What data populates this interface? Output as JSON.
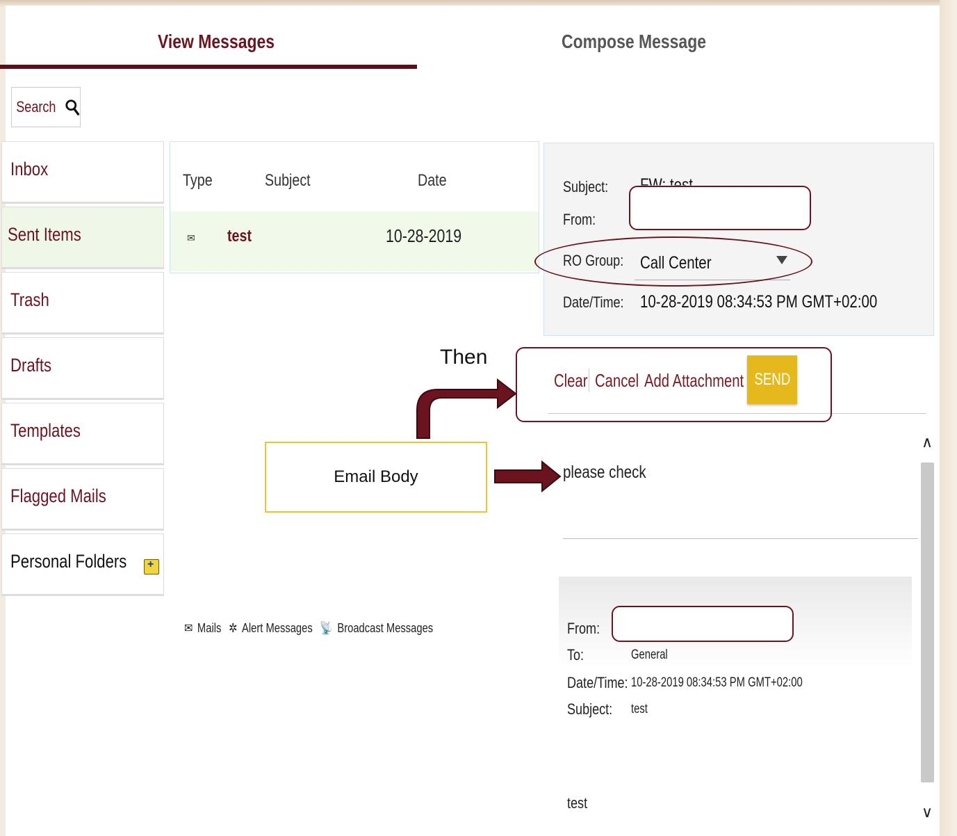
{
  "tabs": {
    "view": "View Messages",
    "compose": "Compose Message"
  },
  "search": {
    "label": "Search"
  },
  "sidebar": {
    "items": [
      {
        "label": "Inbox"
      },
      {
        "label": "Sent Items"
      },
      {
        "label": "Trash"
      },
      {
        "label": "Drafts"
      },
      {
        "label": "Templates"
      },
      {
        "label": "Flagged Mails"
      },
      {
        "label": "Personal Folders"
      }
    ]
  },
  "message_list": {
    "headers": {
      "type": "Type",
      "subject": "Subject",
      "date": "Date"
    },
    "rows": [
      {
        "subject": "test",
        "date": "10-28-2019"
      }
    ]
  },
  "legend": {
    "mails": "Mails",
    "alerts": "Alert Messages",
    "broadcast": "Broadcast Messages"
  },
  "detail": {
    "subject_label": "Subject:",
    "subject_value": "FW: test",
    "from_label": "From:",
    "ro_group_label": "RO Group:",
    "ro_group_value": "Call Center",
    "datetime_label": "Date/Time:",
    "datetime_value": "10-28-2019 08:34:53 PM GMT+02:00"
  },
  "actions": {
    "clear": "Clear",
    "cancel": "Cancel",
    "add_attachment": "Add Attachment",
    "send": "SEND"
  },
  "body": {
    "text": "please check",
    "quoted": {
      "from_label": "From:",
      "to_label": "To:",
      "to_value": "General",
      "datetime_label": "Date/Time:",
      "datetime_value": "10-28-2019 08:34:53 PM GMT+02:00",
      "subject_label": "Subject:",
      "subject_value": "test",
      "body": "test"
    }
  },
  "annotations": {
    "email_body": "Email Body",
    "then": "Then"
  },
  "colors": {
    "brand": "#6b1420",
    "send": "#e5b81b",
    "active_row": "#f1faea",
    "callout_box": "#f2c230"
  }
}
